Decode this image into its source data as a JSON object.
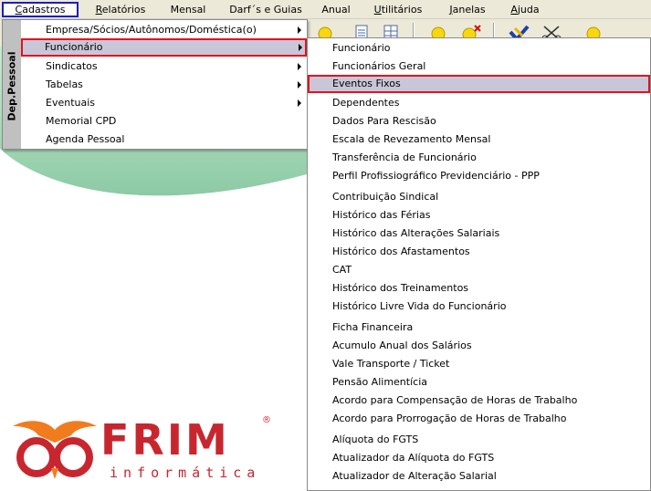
{
  "menubar": {
    "items": [
      {
        "label": "Cadastros",
        "accel": "C"
      },
      {
        "label": "Relatórios",
        "accel": "R"
      },
      {
        "label": "Mensal"
      },
      {
        "label": "Darf´s e Guias"
      },
      {
        "label": "Anual"
      },
      {
        "label": "Utilitários",
        "accel": "U"
      },
      {
        "label": "Janelas",
        "accel": "J"
      },
      {
        "label": "Ajuda",
        "accel": "A"
      }
    ]
  },
  "toolbar": {
    "icons": [
      "yellow-circle-icon",
      "document-icon",
      "grid-document-icon",
      "yellow-circle-icon",
      "yellow-circle-delete-icon",
      "check-mark-icon",
      "scissors-icon",
      "yellow-circle-icon"
    ]
  },
  "menu1": {
    "side_label": "Dep.Pessoal",
    "items": [
      {
        "label": "Empresa/Sócios/Autônomos/Doméstica(o)",
        "submenu": true
      },
      {
        "label": "Funcionário",
        "submenu": true,
        "selected": true
      },
      {
        "label": "Sindicatos",
        "submenu": true
      },
      {
        "label": "Tabelas",
        "submenu": true
      },
      {
        "label": "Eventuais",
        "submenu": true
      },
      {
        "label": "Memorial CPD",
        "submenu": false
      },
      {
        "label": "Agenda Pessoal",
        "submenu": false
      }
    ]
  },
  "menu2": {
    "items": [
      {
        "label": "Funcionário"
      },
      {
        "label": "Funcionários Geral"
      },
      {
        "label": "Eventos Fixos",
        "selected": true
      },
      {
        "label": "Dependentes"
      },
      {
        "label": "Dados Para  Rescisão"
      },
      {
        "label": "Escala de Revezamento Mensal"
      },
      {
        "label": "Transferência de Funcionário"
      },
      {
        "label": "Perfil Profissiográfico Previdenciário - PPP"
      },
      {
        "label": "Contribuição Sindical"
      },
      {
        "label": "Histórico das Férias"
      },
      {
        "label": "Histórico das Alterações  Salariais"
      },
      {
        "label": "Histórico dos Afastamentos"
      },
      {
        "label": "CAT"
      },
      {
        "label": "Histórico dos Treinamentos"
      },
      {
        "label": "Histórico Livre Vida do Funcionário"
      },
      {
        "label": "Ficha Financeira"
      },
      {
        "label": "Acumulo Anual dos Salários"
      },
      {
        "label": "Vale Transporte / Ticket"
      },
      {
        "label": "Pensão Alimentícia"
      },
      {
        "label": "Acordo para Compensação de Horas de Trabalho"
      },
      {
        "label": "Acordo para Prorrogação de Horas de Trabalho"
      },
      {
        "label": "Alíquota do FGTS"
      },
      {
        "label": "Atualizador da Alíquota do FGTS"
      },
      {
        "label": "Atualizador de Alteração Salarial"
      }
    ]
  },
  "logo": {
    "word": "FRIM",
    "sub": "informática",
    "reg": "®"
  },
  "colors": {
    "menu_highlight": "#c9c6d9",
    "selection_border": "#e0141c",
    "logo_red": "#c8262e",
    "logo_orange": "#f07c1e",
    "workspace_green": "#a8d8b8"
  }
}
